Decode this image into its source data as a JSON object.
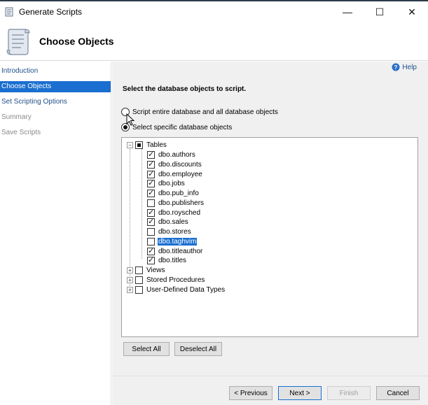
{
  "window": {
    "title": "Generate Scripts",
    "minimize": "—",
    "maximize": "☐",
    "close": "✕"
  },
  "header": {
    "title": "Choose Objects"
  },
  "sidebar": {
    "items": [
      {
        "label": "Introduction",
        "state": "link"
      },
      {
        "label": "Choose Objects",
        "state": "active"
      },
      {
        "label": "Set Scripting Options",
        "state": "link"
      },
      {
        "label": "Summary",
        "state": "disabled"
      },
      {
        "label": "Save Scripts",
        "state": "disabled"
      }
    ]
  },
  "main": {
    "help_label": "Help",
    "instruction": "Select the database objects to script.",
    "options": {
      "entire": "Script entire database and all database objects",
      "specific": "Select specific database objects"
    },
    "tree": {
      "tables_label": "Tables",
      "tables": [
        {
          "label": "dbo.authors",
          "checked": true
        },
        {
          "label": "dbo.discounts",
          "checked": true
        },
        {
          "label": "dbo.employee",
          "checked": true
        },
        {
          "label": "dbo.jobs",
          "checked": true
        },
        {
          "label": "dbo.pub_info",
          "checked": true
        },
        {
          "label": "dbo.publishers",
          "checked": false
        },
        {
          "label": "dbo.roysched",
          "checked": true
        },
        {
          "label": "dbo.sales",
          "checked": true
        },
        {
          "label": "dbo.stores",
          "checked": false
        },
        {
          "label": "dbo.taghvim",
          "checked": false
        },
        {
          "label": "dbo.titleauthor",
          "checked": true
        },
        {
          "label": "dbo.titles",
          "checked": true
        }
      ],
      "other_nodes": [
        {
          "label": "Views"
        },
        {
          "label": "Stored Procedures"
        },
        {
          "label": "User-Defined Data Types"
        }
      ]
    },
    "select_all": "Select All",
    "deselect_all": "Deselect All"
  },
  "footer": {
    "previous": "< Previous",
    "next": "Next >",
    "finish": "Finish",
    "cancel": "Cancel"
  }
}
